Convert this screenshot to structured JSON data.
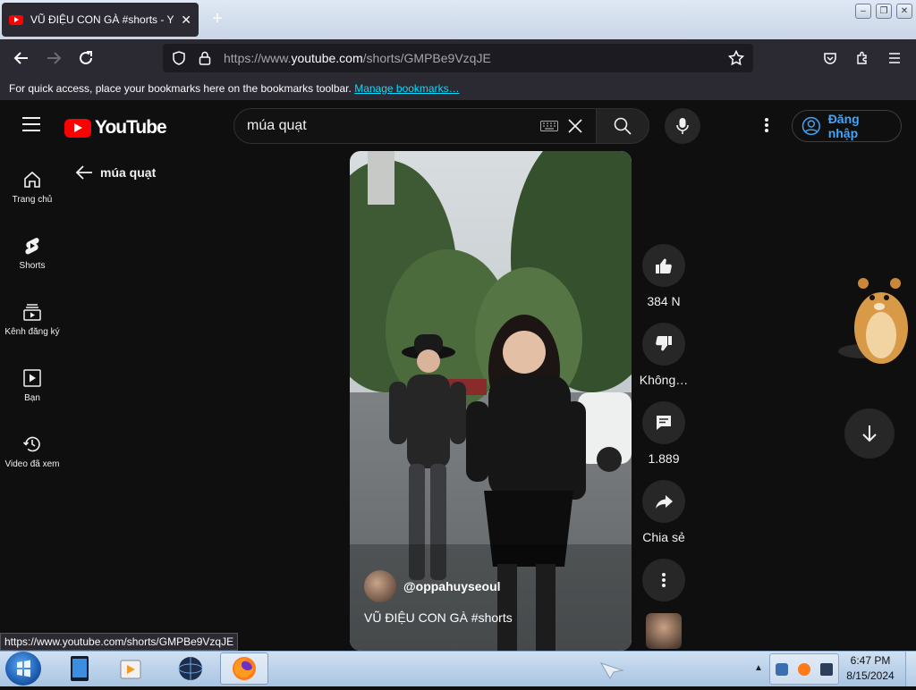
{
  "browser": {
    "tab_title": "VŨ ĐIỆU CON GÀ #shorts - YouTube",
    "tab_close": "✕",
    "new_tab": "+",
    "url_prefix": "https://www.",
    "url_domain": "youtube.com",
    "url_path": "/shorts/GMPBe9VzqJE",
    "bookmarks_hint": "For quick access, place your bookmarks here on the bookmarks toolbar.",
    "manage_bookmarks": "Manage bookmarks…",
    "status_url": "https://www.youtube.com/shorts/GMPBe9VzqJE"
  },
  "youtube": {
    "logo_text": "YouTube",
    "search_query": "múa quạt",
    "sign_in_label": "Đăng nhập",
    "back_label": "múa quạt",
    "sidebar": [
      {
        "label": "Trang chủ",
        "icon": "home-icon"
      },
      {
        "label": "Shorts",
        "icon": "shorts-icon"
      },
      {
        "label": "Kênh đăng ký",
        "icon": "subscriptions-icon"
      },
      {
        "label": "Bạn",
        "icon": "you-icon"
      },
      {
        "label": "Video đã xem",
        "icon": "history-icon"
      }
    ],
    "short": {
      "channel": "@oppahuyseoul",
      "title": "VŨ ĐIỆU CON GÀ #shorts"
    },
    "actions": {
      "like_count": "384 N",
      "dislike_label": "Không…",
      "comment_count": "1.889",
      "share_label": "Chia sẻ"
    }
  },
  "taskbar": {
    "time": "6:47 PM",
    "date": "8/15/2024"
  },
  "colors": {
    "youtube_red": "#ff0000",
    "link_blue": "#3ea6ff",
    "background": "#0f0f0f"
  }
}
